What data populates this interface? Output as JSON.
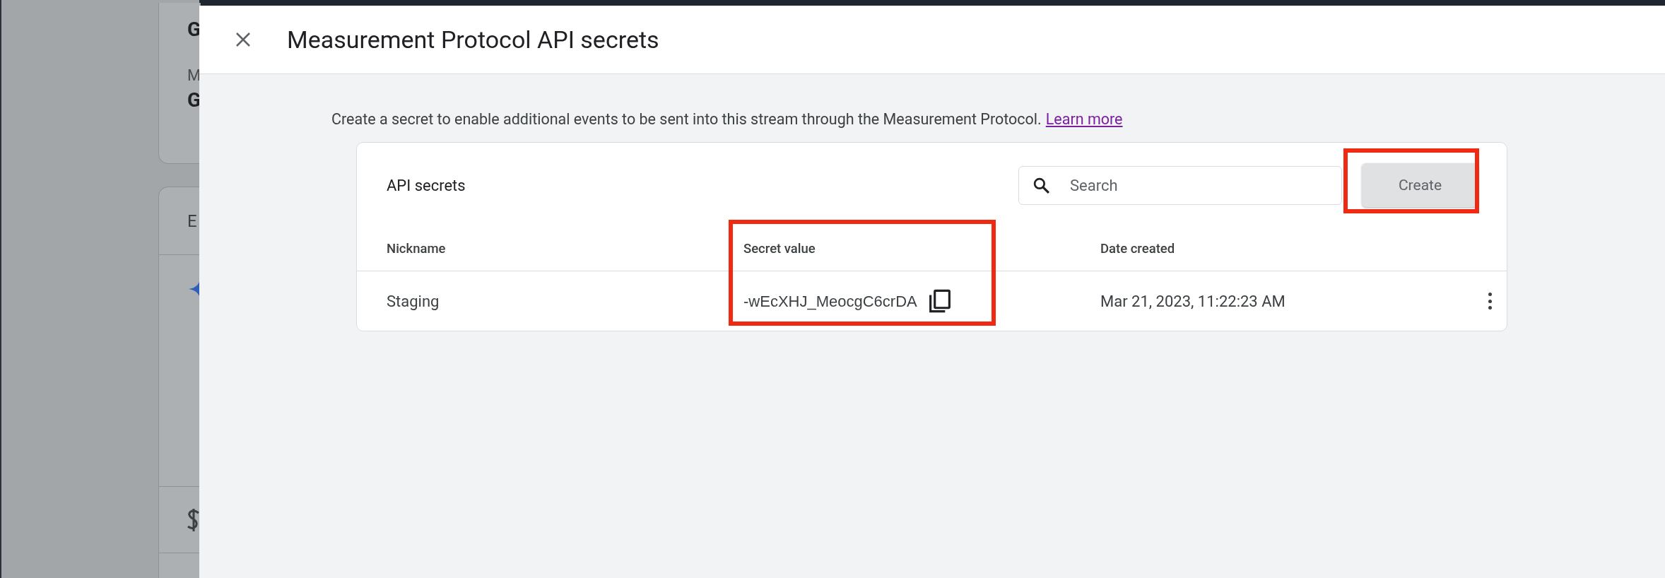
{
  "background": {
    "card_texts": [
      "G",
      "M",
      "G"
    ],
    "section_title": "E"
  },
  "dialog": {
    "title": "Measurement Protocol API secrets",
    "description": "Create a secret to enable additional events to be sent into this stream through the Measurement Protocol.",
    "link": "Learn more",
    "table": {
      "title": "API secrets",
      "search": {
        "placeholder": "Search"
      },
      "create_button": "Create",
      "columns": [
        "Nickname",
        "Secret value",
        "Date created"
      ],
      "rows": [
        {
          "nickname": "Staging",
          "secret": "-wEcXHJ_MeocgC6crDA",
          "date": "Mar 21, 2023, 11:22:23 AM"
        }
      ]
    }
  }
}
